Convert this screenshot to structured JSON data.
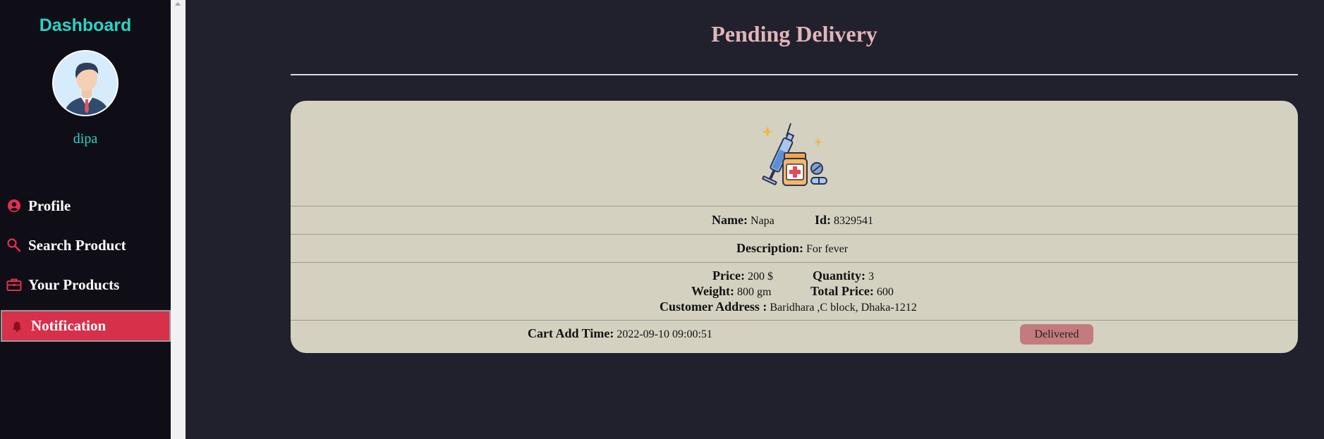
{
  "sidebar": {
    "title": "Dashboard",
    "username": "dipa",
    "items": [
      {
        "label": "Profile",
        "icon": "user-circle-icon"
      },
      {
        "label": "Search Product",
        "icon": "search-icon"
      },
      {
        "label": "Your Products",
        "icon": "briefcase-icon"
      },
      {
        "label": "Notification",
        "icon": "bell-icon",
        "active": true
      }
    ]
  },
  "main": {
    "title": "Pending Delivery",
    "order": {
      "name_label": "Name:",
      "name": "Napa",
      "id_label": "Id:",
      "id": "8329541",
      "description_label": "Description:",
      "description": "For fever",
      "price_label": "Price:",
      "price": "200 $",
      "quantity_label": "Quantity:",
      "quantity": "3",
      "weight_label": "Weight:",
      "weight": "800 gm",
      "total_label": "Total Price:",
      "total": "600",
      "address_label": "Customer Address :",
      "address": "Baridhara ,C block, Dhaka-1212",
      "cart_time_label": "Cart Add Time:",
      "cart_time": "2022-09-10 09:00:51",
      "status": "Delivered"
    }
  },
  "colors": {
    "accent_teal": "#2ad4c4",
    "active_nav": "#d7304a",
    "title_pink": "#e1b5b9",
    "card_bg": "#d4d1c1",
    "badge": "#c47b7d"
  }
}
